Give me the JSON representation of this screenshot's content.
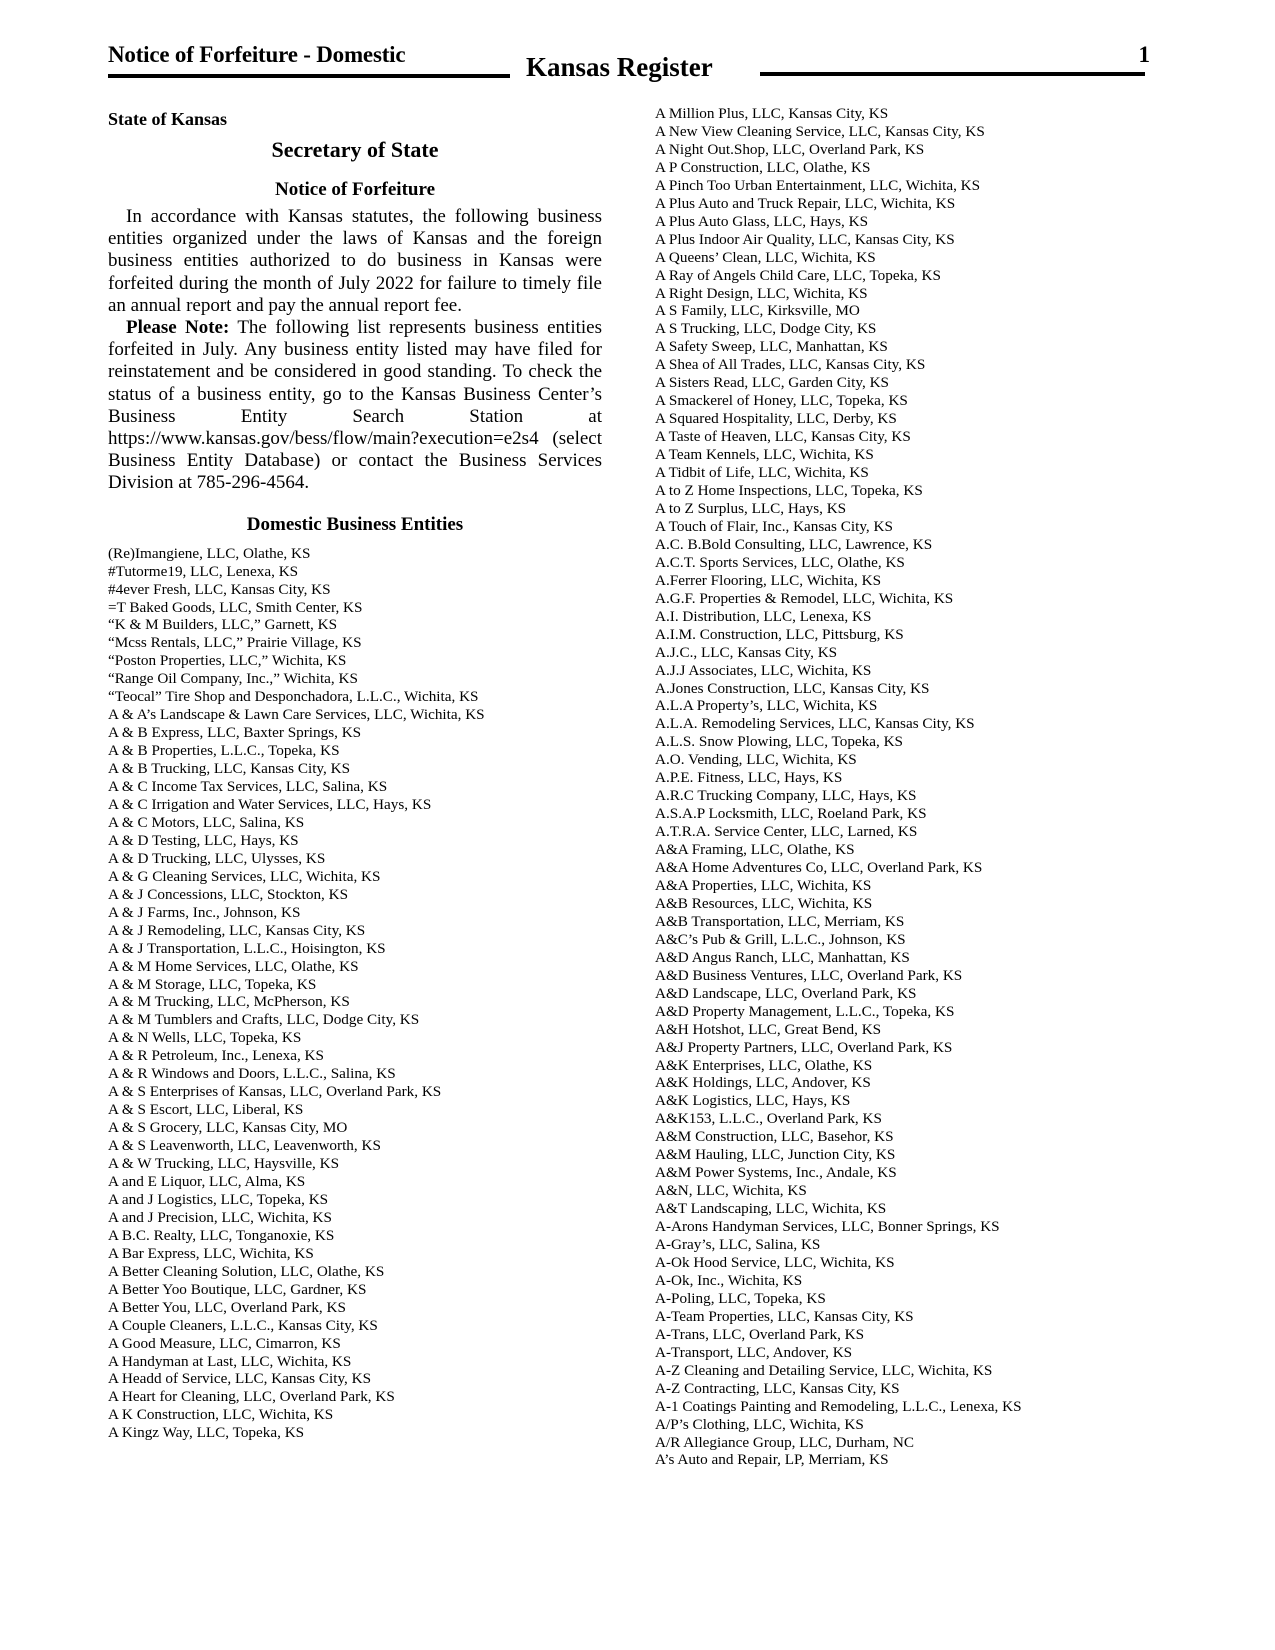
{
  "header": {
    "section_title": "Notice of Forfeiture - Domestic",
    "publication": "Kansas Register",
    "page_number": "1"
  },
  "notice": {
    "state": "State of Kansas",
    "agency": "Secretary of State",
    "title": "Notice of Forfeiture",
    "paragraph1": "In accordance with Kansas statutes, the following business entities organized under the laws of Kansas and the foreign business entities authorized to do business in Kansas were forfeited during the month of July 2022 for failure to timely file an annual report and pay the annual report fee.",
    "note_label": "Please Note:",
    "paragraph2": " The following list represents business entities forfeited in July. Any business entity listed may have filed for reinstatement and be considered in good standing. To check the status of a business entity, go to the Kansas Business Center’s Business Entity Search Station at https://www.kansas.gov/bess/flow/main?execution=e2s4 (select Business Entity Database) or contact the Business Services Division at 785-296-4564.",
    "section_heading": "Domestic Business Entities"
  },
  "entities_left": [
    "(Re)Imangiene, LLC, Olathe, KS",
    "#Tutorme19, LLC, Lenexa, KS",
    "#4ever Fresh, LLC, Kansas City, KS",
    "=T Baked Goods, LLC, Smith Center, KS",
    "“K & M Builders, LLC,” Garnett, KS",
    "“Mcss Rentals, LLC,” Prairie Village, KS",
    "“Poston Properties, LLC,” Wichita, KS",
    "“Range Oil Company, Inc.,” Wichita, KS",
    "“Teocal” Tire Shop and Desponchadora, L.L.C., Wichita, KS",
    "A & A’s Landscape & Lawn Care Services, LLC, Wichita, KS",
    "A & B Express, LLC, Baxter Springs, KS",
    "A & B Properties, L.L.C., Topeka, KS",
    "A & B Trucking, LLC, Kansas City, KS",
    "A & C Income Tax Services, LLC, Salina, KS",
    "A & C Irrigation and Water Services, LLC, Hays, KS",
    "A & C Motors, LLC, Salina, KS",
    "A & D Testing, LLC, Hays, KS",
    "A & D Trucking, LLC, Ulysses, KS",
    "A & G Cleaning Services, LLC, Wichita, KS",
    "A & J Concessions, LLC, Stockton, KS",
    "A & J Farms, Inc., Johnson, KS",
    "A & J Remodeling, LLC, Kansas City, KS",
    "A & J Transportation, L.L.C., Hoisington, KS",
    "A & M Home Services, LLC, Olathe, KS",
    "A & M Storage, LLC, Topeka, KS",
    "A & M Trucking, LLC, McPherson, KS",
    "A & M Tumblers and Crafts, LLC, Dodge City, KS",
    "A & N Wells, LLC, Topeka, KS",
    "A & R Petroleum, Inc., Lenexa, KS",
    "A & R Windows and Doors, L.L.C., Salina, KS",
    "A & S Enterprises of Kansas, LLC, Overland Park, KS",
    "A & S Escort, LLC, Liberal, KS",
    "A & S Grocery, LLC, Kansas City, MO",
    "A & S Leavenworth, LLC, Leavenworth, KS",
    "A & W Trucking, LLC, Haysville, KS",
    "A and E Liquor, LLC, Alma, KS",
    "A and J Logistics, LLC, Topeka, KS",
    "A and J Precision, LLC, Wichita, KS",
    "A B.C. Realty, LLC, Tonganoxie, KS",
    "A Bar Express, LLC, Wichita, KS",
    "A Better Cleaning Solution, LLC, Olathe, KS",
    "A Better Yoo Boutique, LLC, Gardner, KS",
    "A Better You, LLC, Overland Park, KS",
    "A Couple Cleaners, L.L.C., Kansas City, KS",
    "A Good Measure, LLC, Cimarron, KS",
    "A Handyman at Last, LLC, Wichita, KS",
    "A Headd of Service, LLC, Kansas City, KS",
    "A Heart for Cleaning, LLC, Overland Park, KS",
    "A K Construction, LLC, Wichita, KS",
    "A Kingz Way, LLC, Topeka, KS"
  ],
  "entities_right": [
    "A Million Plus, LLC, Kansas City, KS",
    "A New View Cleaning Service, LLC, Kansas City, KS",
    "A Night Out.Shop, LLC, Overland Park, KS",
    "A P Construction, LLC, Olathe, KS",
    "A Pinch Too Urban Entertainment, LLC, Wichita, KS",
    "A Plus Auto and Truck Repair, LLC, Wichita, KS",
    "A Plus Auto Glass, LLC, Hays, KS",
    "A Plus Indoor Air Quality, LLC, Kansas City, KS",
    "A Queens’ Clean, LLC, Wichita, KS",
    "A Ray of Angels Child Care, LLC, Topeka, KS",
    "A Right Design, LLC, Wichita, KS",
    "A S Family, LLC, Kirksville, MO",
    "A S Trucking, LLC, Dodge City, KS",
    "A Safety Sweep, LLC, Manhattan, KS",
    "A Shea of All Trades, LLC, Kansas City, KS",
    "A Sisters Read, LLC, Garden City, KS",
    "A Smackerel of Honey, LLC, Topeka, KS",
    "A Squared Hospitality, LLC, Derby, KS",
    "A Taste of Heaven, LLC, Kansas City, KS",
    "A Team Kennels, LLC, Wichita, KS",
    "A Tidbit of Life, LLC, Wichita, KS",
    "A to Z Home Inspections, LLC, Topeka, KS",
    "A to Z Surplus, LLC, Hays, KS",
    "A Touch of Flair, Inc., Kansas City, KS",
    "A.C. B.Bold Consulting, LLC, Lawrence, KS",
    "A.C.T. Sports Services, LLC, Olathe, KS",
    "A.Ferrer Flooring, LLC, Wichita, KS",
    "A.G.F. Properties & Remodel, LLC, Wichita, KS",
    "A.I. Distribution, LLC, Lenexa, KS",
    "A.I.M. Construction, LLC, Pittsburg, KS",
    "A.J.C., LLC, Kansas City, KS",
    "A.J.J Associates, LLC, Wichita, KS",
    "A.Jones Construction, LLC, Kansas City, KS",
    "A.L.A Property’s, LLC, Wichita, KS",
    "A.L.A. Remodeling Services, LLC, Kansas City, KS",
    "A.L.S. Snow Plowing, LLC, Topeka, KS",
    "A.O. Vending, LLC, Wichita, KS",
    "A.P.E. Fitness, LLC, Hays, KS",
    "A.R.C Trucking Company, LLC, Hays, KS",
    "A.S.A.P Locksmith, LLC, Roeland Park, KS",
    "A.T.R.A. Service Center, LLC, Larned, KS",
    "A&A Framing, LLC, Olathe, KS",
    "A&A Home Adventures Co, LLC, Overland Park, KS",
    "A&A Properties, LLC, Wichita, KS",
    "A&B Resources, LLC, Wichita, KS",
    "A&B Transportation, LLC, Merriam, KS",
    "A&C’s Pub & Grill, L.L.C., Johnson, KS",
    "A&D Angus Ranch, LLC, Manhattan, KS",
    "A&D Business Ventures, LLC, Overland Park, KS",
    "A&D Landscape, LLC, Overland Park, KS",
    "A&D Property Management, L.L.C., Topeka, KS",
    "A&H Hotshot, LLC, Great Bend, KS",
    "A&J Property Partners, LLC, Overland Park, KS",
    "A&K Enterprises, LLC, Olathe, KS",
    "A&K Holdings, LLC, Andover, KS",
    "A&K Logistics, LLC, Hays, KS",
    "A&K153, L.L.C., Overland Park, KS",
    "A&M Construction, LLC, Basehor, KS",
    "A&M Hauling, LLC, Junction City, KS",
    "A&M Power Systems, Inc., Andale, KS",
    "A&N, LLC, Wichita, KS",
    "A&T Landscaping, LLC, Wichita, KS",
    "A-Arons Handyman Services, LLC, Bonner Springs, KS",
    "A-Gray’s, LLC, Salina, KS",
    "A-Ok Hood Service, LLC, Wichita, KS",
    "A-Ok, Inc., Wichita, KS",
    "A-Poling, LLC, Topeka, KS",
    "A-Team Properties, LLC, Kansas City, KS",
    "A-Trans, LLC, Overland Park, KS",
    "A-Transport, LLC, Andover, KS",
    "A-Z Cleaning and Detailing Service, LLC, Wichita, KS",
    "A-Z Contracting, LLC, Kansas City, KS",
    "A-1 Coatings Painting and Remodeling, L.L.C., Lenexa, KS",
    "A/P’s Clothing, LLC, Wichita, KS",
    "A/R Allegiance Group, LLC, Durham, NC",
    "A’s Auto and Repair, LP, Merriam, KS"
  ]
}
